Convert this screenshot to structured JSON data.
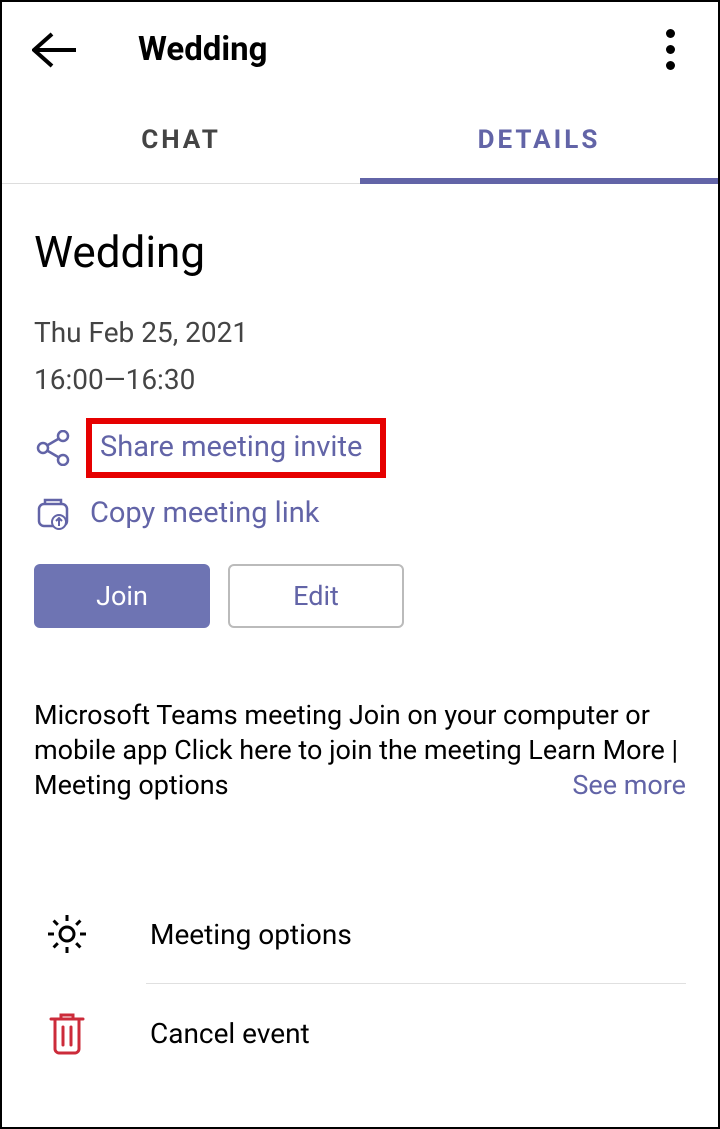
{
  "header": {
    "title": "Wedding"
  },
  "tabs": {
    "chat": "CHAT",
    "details": "DETAILS"
  },
  "event": {
    "title": "Wedding",
    "date": "Thu Feb 25, 2021",
    "time": "16:00—16:30"
  },
  "actions": {
    "share": "Share meeting invite",
    "copy": "Copy meeting link"
  },
  "buttons": {
    "join": "Join",
    "edit": "Edit"
  },
  "description": {
    "text": "Microsoft Teams meeting Join on your computer or mobile app Click here to join the meeting Learn More | Meeting options",
    "see_more": "See more"
  },
  "options": {
    "meeting_options": "Meeting options",
    "cancel_event": "Cancel event"
  }
}
